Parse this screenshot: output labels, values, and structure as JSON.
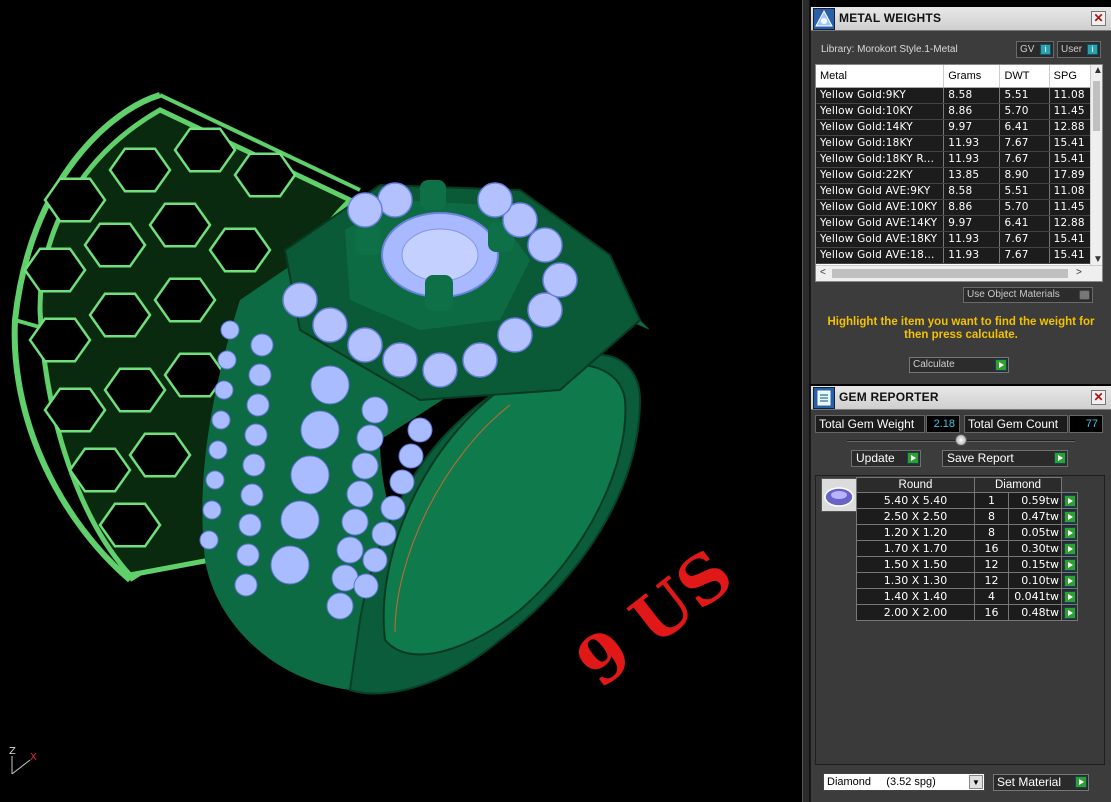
{
  "viewport": {
    "ring_size_text": "9 US",
    "axis": {
      "x_label": "X",
      "z_label": "Z"
    }
  },
  "metal_weights": {
    "title": "METAL WEIGHTS",
    "library_label": "Library: Morokort Style.1-Metal",
    "gv_label": "GV",
    "user_label": "User",
    "columns": [
      "Metal",
      "Grams",
      "DWT",
      "SPG"
    ],
    "rows": [
      [
        "Yellow Gold:9KY",
        "8.58",
        "5.51",
        "11.08"
      ],
      [
        "Yellow Gold:10KY",
        "8.86",
        "5.70",
        "11.45"
      ],
      [
        "Yellow Gold:14KY",
        "9.97",
        "6.41",
        "12.88"
      ],
      [
        "Yellow Gold:18KY",
        "11.93",
        "7.67",
        "15.41"
      ],
      [
        "Yellow Gold:18KY R...",
        "11.93",
        "7.67",
        "15.41"
      ],
      [
        "Yellow Gold:22KY",
        "13.85",
        "8.90",
        "17.89"
      ],
      [
        "Yellow Gold AVE:9KY",
        "8.58",
        "5.51",
        "11.08"
      ],
      [
        "Yellow Gold AVE:10KY",
        "8.86",
        "5.70",
        "11.45"
      ],
      [
        "Yellow Gold AVE:14KY",
        "9.97",
        "6.41",
        "12.88"
      ],
      [
        "Yellow Gold AVE:18KY",
        "11.93",
        "7.67",
        "15.41"
      ],
      [
        "Yellow Gold AVE:18...",
        "11.93",
        "7.67",
        "15.41"
      ]
    ],
    "use_object_materials": "Use Object Materials",
    "hint": "Highlight the item you want to find the weight for then press calculate.",
    "calculate_label": "Calculate"
  },
  "gem_reporter": {
    "title": "GEM REPORTER",
    "total_weight_label": "Total Gem Weight",
    "total_weight_value": "2.18",
    "total_count_label": "Total Gem Count",
    "total_count_value": "77",
    "update_label": "Update",
    "save_report_label": "Save Report",
    "table_headers": [
      "Round",
      "Diamond"
    ],
    "rows": [
      [
        "5.40 X 5.40",
        "1",
        "0.59tw"
      ],
      [
        "2.50 X 2.50",
        "8",
        "0.47tw"
      ],
      [
        "1.20 X 1.20",
        "8",
        "0.05tw"
      ],
      [
        "1.70 X 1.70",
        "16",
        "0.30tw"
      ],
      [
        "1.50 X 1.50",
        "12",
        "0.15tw"
      ],
      [
        "1.30 X 1.30",
        "12",
        "0.10tw"
      ],
      [
        "1.40 X 1.40",
        "4",
        "0.041tw"
      ],
      [
        "2.00 X 2.00",
        "16",
        "0.48tw"
      ]
    ],
    "material_select": "Diamond     (3.52 spg)",
    "set_material_label": "Set Material"
  }
}
